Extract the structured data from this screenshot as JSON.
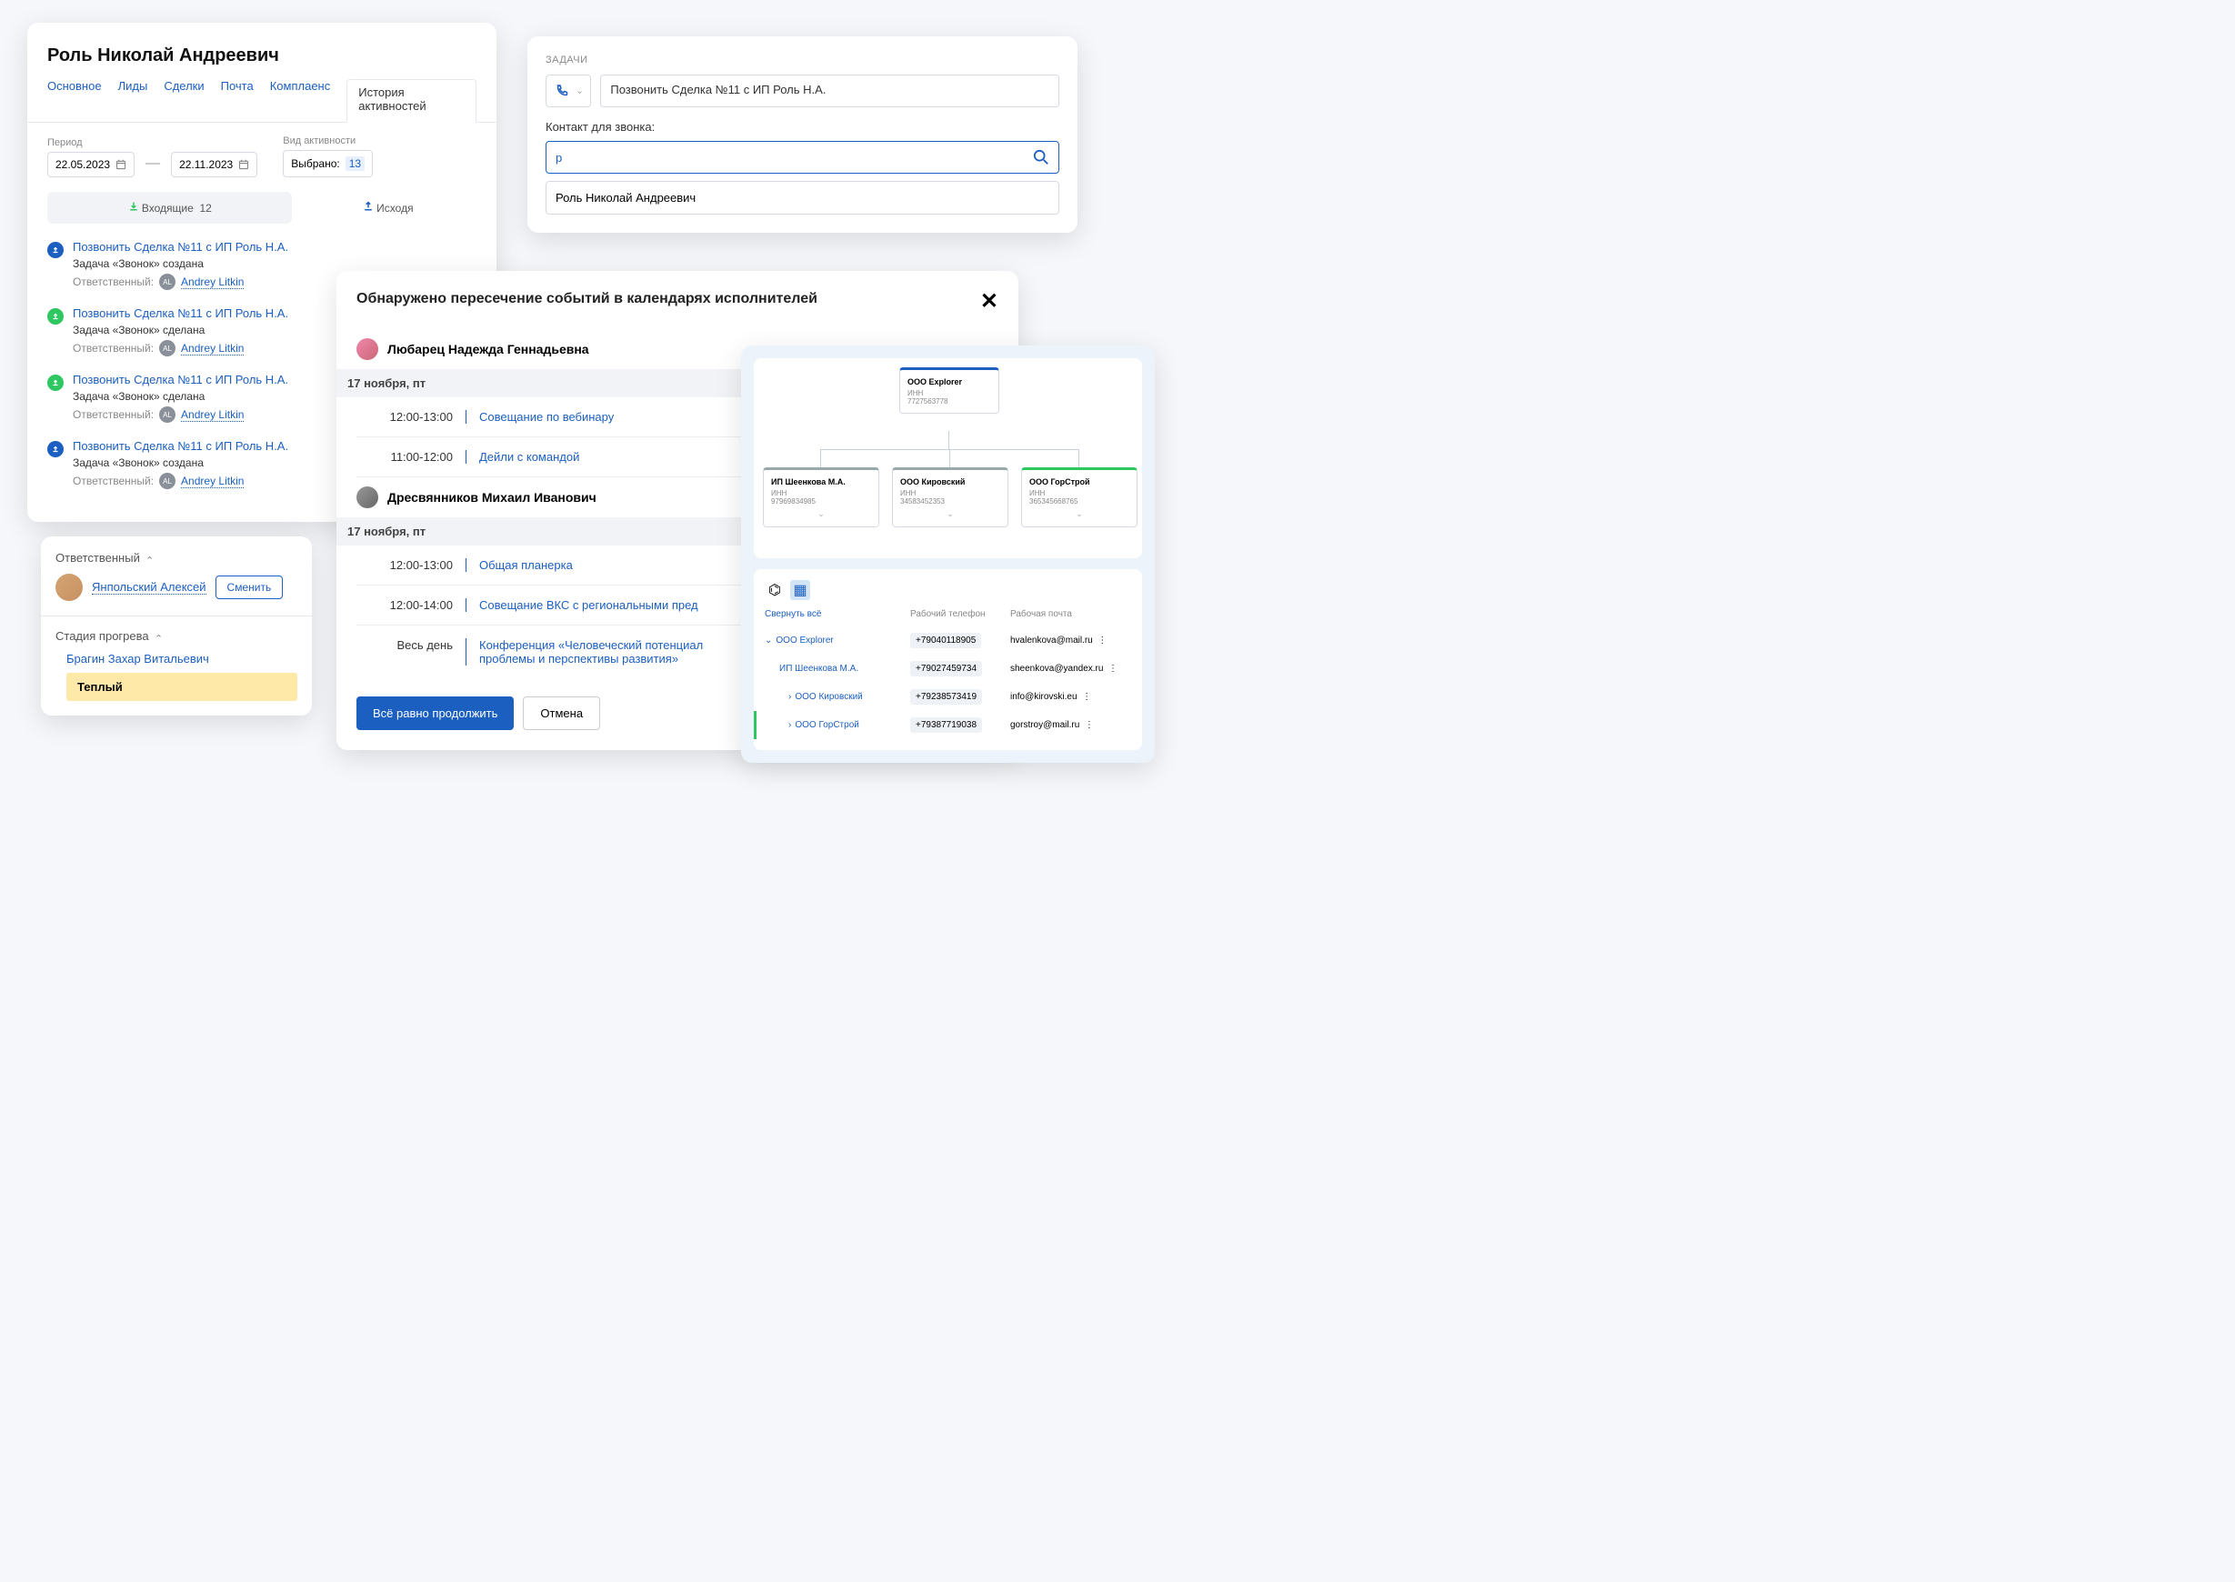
{
  "c1": {
    "title": "Роль Николай Андреевич",
    "tabs": [
      "Основное",
      "Лиды",
      "Сделки",
      "Почта",
      "Комплаенс",
      "История активностей"
    ],
    "period_label": "Период",
    "date_from": "22.05.2023",
    "date_to": "22.11.2023",
    "activity_label": "Вид активности",
    "selected_label": "Выбрано:",
    "selected_count": "13",
    "incoming_label": "Входящие",
    "incoming_count": "12",
    "outgoing_label": "Исходя",
    "items": [
      {
        "title": "Позвонить Сделка №11 с ИП Роль Н.А.",
        "sub": "Задача «Звонок» создана",
        "resp": "Ответственный:",
        "av": "AL",
        "name": "Andrey Litkin",
        "color": "blue"
      },
      {
        "title": "Позвонить Сделка №11 с ИП Роль Н.А.",
        "sub": "Задача «Звонок» сделана",
        "resp": "Ответственный:",
        "av": "AL",
        "name": "Andrey Litkin",
        "color": "green"
      },
      {
        "title": "Позвонить Сделка №11 с ИП Роль Н.А.",
        "sub": "Задача «Звонок» сделана",
        "resp": "Ответственный:",
        "av": "AL",
        "name": "Andrey Litkin",
        "color": "green"
      },
      {
        "title": "Позвонить Сделка №11 с ИП Роль Н.А.",
        "sub": "Задача «Звонок» создана",
        "resp": "Ответственный:",
        "av": "AL",
        "name": "Andrey Litkin",
        "color": "blue"
      }
    ]
  },
  "c2": {
    "label": "ЗАДАЧИ",
    "task_title": "Позвонить Сделка №11 с ИП Роль Н.А.",
    "contact_label": "Контакт для звонка:",
    "search_value": "р",
    "suggestion": "Роль Николай Андреевич"
  },
  "c3": {
    "section1": "Ответственный",
    "name": "Янпольский Алексей",
    "change": "Сменить",
    "section2": "Стадия прогрева",
    "contact": "Брагин Захар Витальевич",
    "stage": "Теплый"
  },
  "c4": {
    "title": "Обнаружено пересечение событий  в календарях исполнителей",
    "p1": "Любарец Надежда Геннадьевна",
    "day": "17 ноября, пт",
    "p1e1_t": "12:00-13:00",
    "p1e1_n": "Совещание по вебинару",
    "p1e2_t": "11:00-12:00",
    "p1e2_n": "Дейли с командой",
    "p2": "Дресвянников Михаил Иванович",
    "p2e1_t": "12:00-13:00",
    "p2e1_n": "Общая планерка",
    "p2e2_t": "12:00-14:00",
    "p2e2_n": "Совещание ВКС с региональными пред",
    "p2e3_t": "Весь день",
    "p2e3_n": "Конференция «Человеческий потенциал проблемы и перспективы  развития»",
    "btn_continue": "Всё равно продолжить",
    "btn_cancel": "Отмена"
  },
  "c5": {
    "root": {
      "name": "ООО Explorer",
      "inn_l": "ИНН",
      "inn": "7727563778"
    },
    "ch1": {
      "name": "ИП Шеенкова М.А.",
      "inn_l": "ИНН",
      "inn": "97969834985"
    },
    "ch2": {
      "name": "ООО Кировский",
      "inn_l": "ИНН",
      "inn": "34583452353"
    },
    "ch3": {
      "name": "ООО ГорСтрой",
      "inn_l": "ИНН",
      "inn": "365345668765"
    },
    "collapse": "Свернуть всё",
    "col_phone": "Рабочий телефон",
    "col_email": "Рабочая почта",
    "rows": [
      {
        "name": "ООО Explorer",
        "phone": "+79040118905",
        "email": "hvalenkova@mail.ru",
        "indent": 0,
        "expand": "down"
      },
      {
        "name": "ИП Шеенкова М.А.",
        "phone": "+79027459734",
        "email": "sheenkova@yandex.ru",
        "indent": 1,
        "expand": ""
      },
      {
        "name": "ООО Кировский",
        "phone": "+79238573419",
        "email": "info@kirovski.eu",
        "indent": 2,
        "expand": "right"
      },
      {
        "name": "ООО ГорСтрой",
        "phone": "+79387719038",
        "email": "gorstroy@mail.ru",
        "indent": 2,
        "expand": "right",
        "bar": true
      }
    ]
  }
}
